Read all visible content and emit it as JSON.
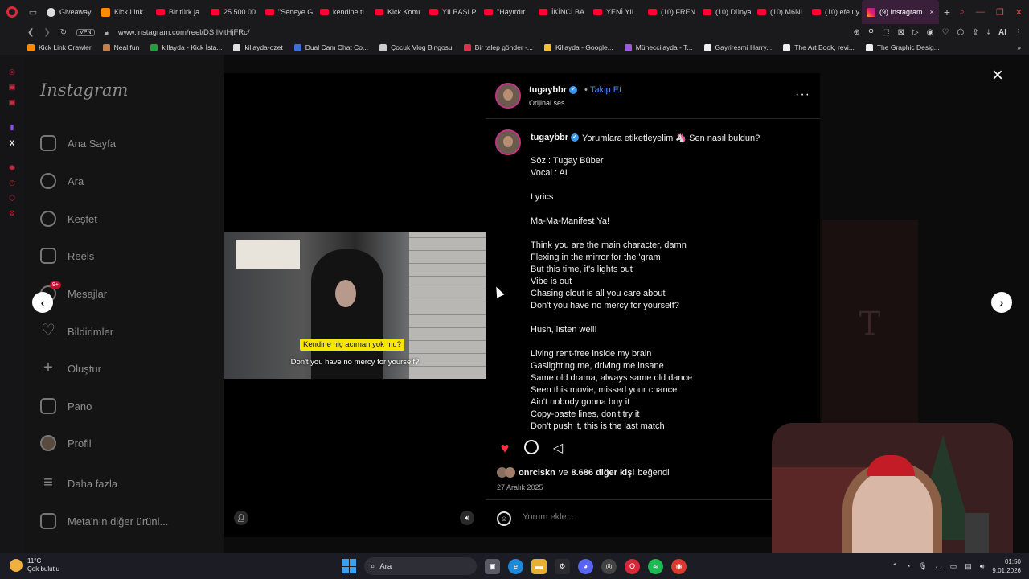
{
  "browser": {
    "tabs": [
      {
        "label": "Giveaway",
        "type": "round"
      },
      {
        "label": "Kick Link",
        "type": "kick"
      },
      {
        "label": "Bir türk ja",
        "type": "yt"
      },
      {
        "label": "25.500.00",
        "type": "yt"
      },
      {
        "label": "\"Seneye G",
        "type": "yt"
      },
      {
        "label": "kendine tı",
        "type": "yt"
      },
      {
        "label": "Kick Komı",
        "type": "yt"
      },
      {
        "label": "YILBAŞI P",
        "type": "yt"
      },
      {
        "label": "\"Hayırdır",
        "type": "yt"
      },
      {
        "label": "İKİNCİ BA",
        "type": "yt"
      },
      {
        "label": "YENİ YIL",
        "type": "yt"
      },
      {
        "label": "(10) FREN",
        "type": "yt"
      },
      {
        "label": "(10) Dünya",
        "type": "yt"
      },
      {
        "label": "(10) M6NI",
        "type": "yt"
      },
      {
        "label": "(10) efe uy",
        "type": "yt"
      }
    ],
    "active_tab": "(9) Instagram",
    "url": "www.instagram.com/reel/DSIlMtHjFRc/",
    "vpn_label": "VPN",
    "ai_label": "AI",
    "bookmarks": [
      "Kick Link Crawler",
      "Neal.fun",
      "killayda - Kick İsta...",
      "killayda-ozet",
      "Dual Cam Chat Co...",
      "Çocuk Vlog Bingosu",
      "Bir talep gönder -...",
      "Killayda - Google...",
      "Müneccilayda - T...",
      "Gayriresmi Harry...",
      "The Art Book, revi...",
      "The Graphic Desig..."
    ]
  },
  "instagram": {
    "logo": "Instagram",
    "nav": [
      {
        "label": "Ana Sayfa",
        "icon": "home-icon"
      },
      {
        "label": "Ara",
        "icon": "search-icon"
      },
      {
        "label": "Keşfet",
        "icon": "compass-icon"
      },
      {
        "label": "Reels",
        "icon": "reels-icon"
      },
      {
        "label": "Mesajlar",
        "icon": "messenger-icon",
        "badge": "9+"
      },
      {
        "label": "Bildirimler",
        "icon": "heart-icon"
      },
      {
        "label": "Oluştur",
        "icon": "plus-icon"
      },
      {
        "label": "Pano",
        "icon": "dashboard-icon"
      },
      {
        "label": "Profil",
        "icon": "avatar-icon"
      },
      {
        "label": "Daha fazla",
        "icon": "menu-icon"
      },
      {
        "label": "Meta'nın diğer ürünl...",
        "icon": "meta-icon"
      }
    ],
    "background_letter": "T"
  },
  "reel": {
    "subtitle_tr": "Kendine hiç acıman yok mu?",
    "subtitle_en": "Don't you have no mercy for yourself?"
  },
  "post": {
    "username": "tugaybbr",
    "follow_label": "Takip Et",
    "audio_label": "Orijinal ses",
    "caption_first_line": "Yorumlara etiketleyelim 🦄 Sen nasıl buldun?",
    "caption_lines": [
      "Söz : Tugay Büber",
      "Vocal : AI",
      "",
      "Lyrics",
      "",
      "Ma-Ma-Manifest Ya!",
      "",
      "Think you are the main character, damn",
      "Flexing in the mirror for the 'gram",
      "But this time, it's lights out",
      "Vibe is out",
      "Chasing clout is all you care about",
      "Don't you have no mercy for yourself?",
      "",
      "Hush, listen well!",
      "",
      "Living rent-free inside my brain",
      "Gaslighting me, driving me insane",
      "Same old drama, always same old dance",
      "Seen this movie, missed your chance",
      "Ain't nobody gonna buy it",
      "Copy-paste lines, don't try it",
      "Don't push it, this is the last match"
    ],
    "likes_user": "onrclskn",
    "likes_mid": "ve",
    "likes_count": "8.686 diğer kişi",
    "likes_suffix": "beğendi",
    "date": "27 Aralık 2025",
    "comment_placeholder": "Yorum ekle..."
  },
  "taskbar": {
    "temperature": "11°C",
    "weather_text": "Çok bulutlu",
    "search_label": "Ara",
    "time": "01:50",
    "date": "9.01.2026"
  }
}
